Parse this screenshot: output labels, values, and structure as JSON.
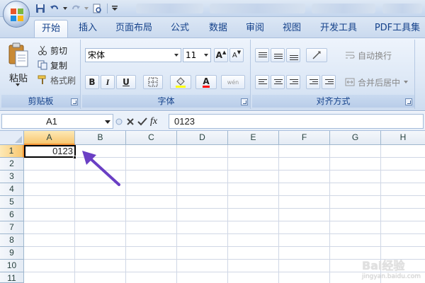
{
  "qat": {
    "icons": [
      "save-icon",
      "undo-icon",
      "redo-icon",
      "preview-icon"
    ]
  },
  "tabs": [
    {
      "label": "开始",
      "active": true
    },
    {
      "label": "插入"
    },
    {
      "label": "页面布局"
    },
    {
      "label": "公式"
    },
    {
      "label": "数据"
    },
    {
      "label": "审阅"
    },
    {
      "label": "视图"
    },
    {
      "label": "开发工具"
    },
    {
      "label": "PDF工具集"
    }
  ],
  "clipboard": {
    "paste": "粘贴",
    "cut": "剪切",
    "copy": "复制",
    "format_painter": "格式刷",
    "label": "剪贴板"
  },
  "font": {
    "name": "宋体",
    "size": "11",
    "grow": "A",
    "shrink": "A",
    "bold": "B",
    "italic": "I",
    "underline": "U",
    "font_color": "A",
    "phonetic": "wén",
    "label": "字体"
  },
  "alignment": {
    "wrap_text": "自动换行",
    "merge_center": "合并后居中",
    "label": "对齐方式"
  },
  "formula_bar": {
    "name_box": "A1",
    "formula": "0123"
  },
  "grid": {
    "columns": [
      "A",
      "B",
      "C",
      "D",
      "E",
      "F",
      "G",
      "H"
    ],
    "rows": [
      "1",
      "2",
      "3",
      "4",
      "5",
      "6",
      "7",
      "8",
      "9",
      "10",
      "11"
    ],
    "cell_a1": "0123"
  },
  "watermark": {
    "text": "Bai经验",
    "sub": "jingyan.baidu.com"
  },
  "colors": {
    "accent": "#15428b",
    "arrow": "#6a3fc4",
    "selected_header": "#f8c770"
  }
}
